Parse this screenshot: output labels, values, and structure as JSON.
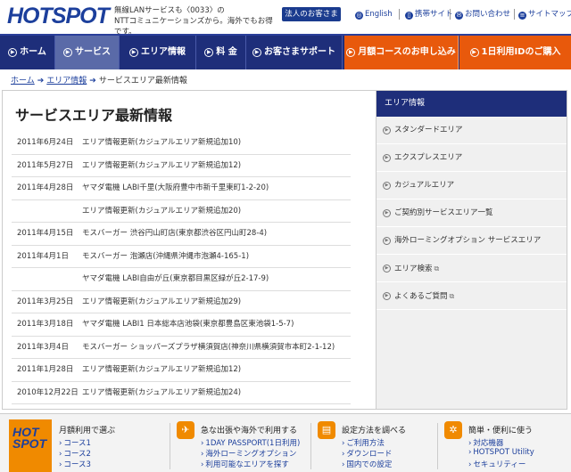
{
  "header": {
    "logo": "HOTSPOT",
    "tagline_line1": "無線LANサービスも〈0033〉の",
    "tagline_line2": "NTTコミュニケーションズから。海外でもお得です。",
    "corporate_button": "法人のお客さま",
    "links": [
      "English",
      "携帯サイト",
      "お問い合わせ",
      "サイトマップ"
    ]
  },
  "nav": {
    "items": [
      "ホーム",
      "サービス",
      "エリア情報",
      "料 金",
      "お客さまサポート"
    ],
    "orange_items": [
      "月額コースのお申し込み",
      "1日利用IDのご購入"
    ],
    "active_index": 1
  },
  "breadcrumb": {
    "home": "ホーム",
    "area": "エリア情報",
    "current": "サービスエリア最新情報"
  },
  "main": {
    "title": "サービスエリア最新情報",
    "news": [
      {
        "date": "2011年6月24日",
        "text": "エリア情報更新(カジュアルエリア新規追加10)"
      },
      {
        "date": "2011年5月27日",
        "text": "エリア情報更新(カジュアルエリア新規追加12)"
      },
      {
        "date": "2011年4月28日",
        "text": "ヤマダ電機 LABI千里(大阪府豊中市新千里東町1-2-20)"
      },
      {
        "date": "",
        "text": "エリア情報更新(カジュアルエリア新規追加20)"
      },
      {
        "date": "2011年4月15日",
        "text": "モスバーガー 渋谷円山町店(東京都渋谷区円山町28-4)"
      },
      {
        "date": "2011年4月1日",
        "text": "モスバーガー 泡瀬店(沖縄県沖縄市泡瀬4-165-1)"
      },
      {
        "date": "",
        "text": "ヤマダ電機 LABI自由が丘(東京都目黒区緑が丘2-17-9)"
      },
      {
        "date": "2011年3月25日",
        "text": "エリア情報更新(カジュアルエリア新規追加29)"
      },
      {
        "date": "2011年3月18日",
        "text": "ヤマダ電機 LABI1 日本総本店池袋(東京都豊島区東池袋1-5-7)"
      },
      {
        "date": "2011年3月4日",
        "text": "モスバーガー ショッパーズプラザ横須賀店(神奈川県横須賀市本町2-1-12)"
      },
      {
        "date": "2011年1月28日",
        "text": "エリア情報更新(カジュアルエリア新規追加12)"
      },
      {
        "date": "2010年12月22日",
        "text": "エリア情報更新(カジュアルエリア新規追加24)"
      }
    ]
  },
  "sidebar": {
    "title": "エリア情報",
    "items": [
      {
        "label": "スタンダードエリア",
        "external": false
      },
      {
        "label": "エクスプレスエリア",
        "external": false
      },
      {
        "label": "カジュアルエリア",
        "external": false
      },
      {
        "label": "ご契約別サービスエリア一覧",
        "external": false
      },
      {
        "label": "海外ローミングオプション サービスエリア",
        "external": false
      },
      {
        "label": "エリア検索",
        "external": true
      },
      {
        "label": "よくあるご質問",
        "external": true
      }
    ]
  },
  "footer": {
    "logo": "HOT SPOT",
    "col1": {
      "heading": "月額利用で選ぶ",
      "links": [
        "コース1",
        "コース2",
        "コース3"
      ]
    },
    "col2": {
      "heading": "急な出張や海外で利用する",
      "links": [
        "1DAY PASSPORT(1日利用)",
        "海外ローミングオプション",
        "利用可能なエリアを探す"
      ]
    },
    "col3": {
      "heading": "設定方法を調べる",
      "links": [
        "ご利用方法",
        "ダウンロード",
        "国内での設定"
      ]
    },
    "col4": {
      "heading": "簡単・便利に使う",
      "links": [
        "対応機器",
        "HOTSPOT Utility",
        "セキュリティー"
      ]
    }
  },
  "colors": {
    "brand": "#1c3f9c",
    "nav": "#1e2e7a",
    "accent": "#e8590c"
  }
}
